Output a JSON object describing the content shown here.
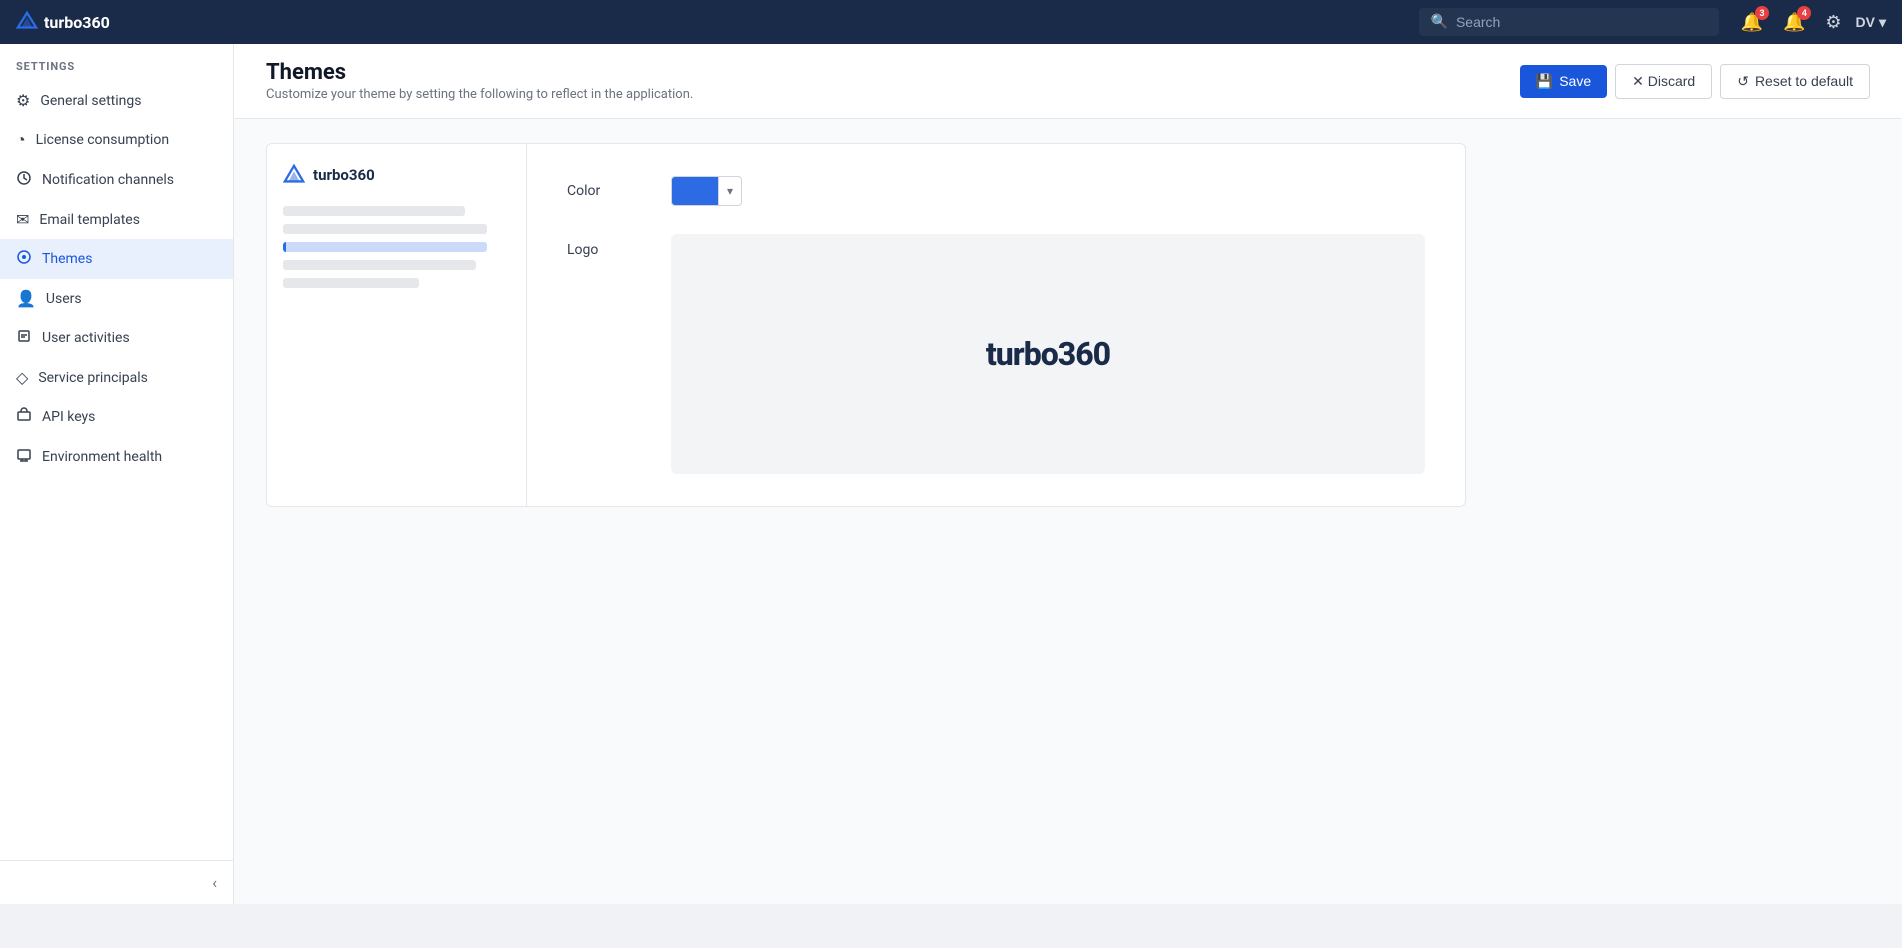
{
  "app": {
    "brand": "turbo360",
    "logo_icon": "▲"
  },
  "topnav": {
    "search_placeholder": "Search",
    "notifications_badge": "3",
    "alerts_badge": "4",
    "user_initials": "DV",
    "chevron": "▾"
  },
  "sidebar": {
    "section_label": "SETTINGS",
    "items": [
      {
        "id": "general-settings",
        "label": "General settings",
        "icon": "⚙"
      },
      {
        "id": "license-consumption",
        "label": "License consumption",
        "icon": "◔"
      },
      {
        "id": "notification-channels",
        "label": "Notification channels",
        "icon": "◑"
      },
      {
        "id": "email-templates",
        "label": "Email templates",
        "icon": "✉"
      },
      {
        "id": "themes",
        "label": "Themes",
        "icon": "🎨",
        "active": true
      },
      {
        "id": "users",
        "label": "Users",
        "icon": "👤"
      },
      {
        "id": "user-activities",
        "label": "User activities",
        "icon": "📋"
      },
      {
        "id": "service-principals",
        "label": "Service principals",
        "icon": "◇"
      },
      {
        "id": "api-keys",
        "label": "API keys",
        "icon": "⌨"
      },
      {
        "id": "environment-health",
        "label": "Environment health",
        "icon": "🖥"
      }
    ],
    "collapse_icon": "‹"
  },
  "page": {
    "title": "Themes",
    "subtitle": "Customize your theme by setting the following to reflect in the application."
  },
  "toolbar": {
    "save_label": "Save",
    "discard_label": "✕ Discard",
    "reset_label": "↺ Reset to default"
  },
  "themes_settings": {
    "color_label": "Color",
    "color_value": "#2d6be4",
    "logo_label": "Logo",
    "logo_text": "turbo360"
  }
}
